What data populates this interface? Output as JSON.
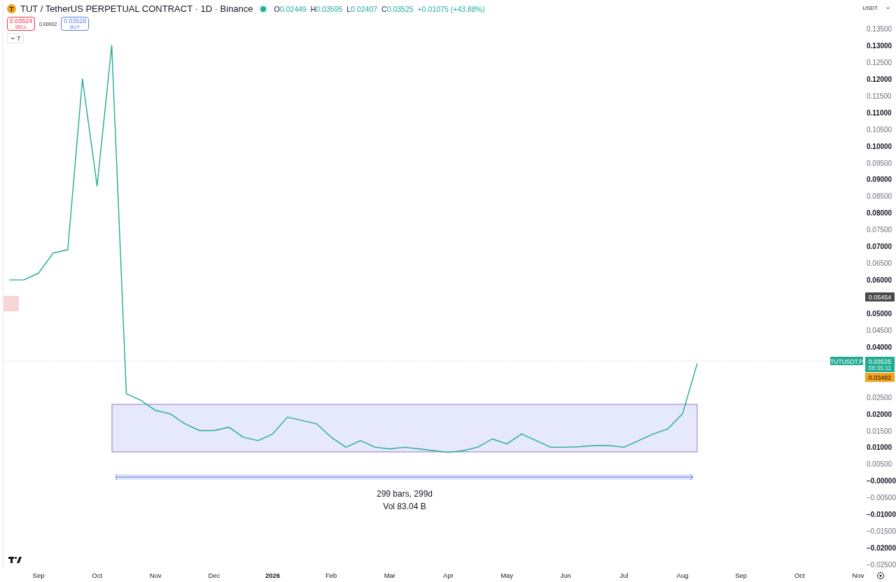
{
  "header": {
    "logo_letter": "T",
    "title": "TUT / TetherUS PERPETUAL CONTRACT · 1D · Binance",
    "market_open": true,
    "ohlc": [
      {
        "label": "O",
        "value": "0.02449"
      },
      {
        "label": "H",
        "value": "0.03595"
      },
      {
        "label": "L",
        "value": "0.02407"
      },
      {
        "label": "C",
        "value": "0.03525"
      }
    ],
    "change": "+0.01075 (+43.88%)",
    "sell": {
      "price": "0.03524",
      "label": "SELL"
    },
    "spread": "0.00002",
    "buy": {
      "price": "0.03526",
      "label": "BUY"
    },
    "indicators_count": "7"
  },
  "currency": "USDT",
  "chart": {
    "chart_data": {
      "type": "line",
      "categories": [
        null,
        null,
        "Sep",
        null,
        null,
        null,
        "Oct",
        null,
        null,
        null,
        "Nov",
        null,
        null,
        null,
        "Dec",
        null,
        null,
        null,
        "2026",
        null,
        null,
        null,
        "Feb",
        null,
        null,
        null,
        "Mar",
        null,
        null,
        null,
        "Apr",
        null,
        null,
        null,
        "May",
        null,
        null,
        null,
        "Jun",
        null,
        null,
        null,
        "Jul",
        null,
        null,
        null,
        "Aug",
        null,
        null,
        null,
        "Sep",
        null,
        null,
        null,
        "Oct",
        null,
        null,
        null,
        "Nov"
      ],
      "series": [
        {
          "name": "TUTUSDT.P",
          "color": "#22ab94",
          "values": [
            0.06,
            0.06,
            0.062,
            0.068,
            0.069,
            0.12,
            0.088,
            0.13,
            0.026,
            0.024,
            0.021,
            0.02,
            0.017,
            0.015,
            0.015,
            0.016,
            0.013,
            0.012,
            0.014,
            0.019,
            0.018,
            0.017,
            0.013,
            0.01,
            0.012,
            0.01,
            0.0095,
            0.01,
            0.0095,
            0.009,
            0.0085,
            0.009,
            0.01,
            0.0125,
            0.011,
            0.014,
            0.012,
            0.01,
            0.01,
            0.0102,
            0.0105,
            0.0105,
            0.01,
            0.012,
            0.014,
            0.0155,
            0.02,
            0.035,
            null,
            null,
            null,
            null,
            null,
            null,
            null,
            null,
            null,
            null,
            null
          ]
        }
      ],
      "ylim": [
        -0.025,
        0.135
      ],
      "yticks": [
        {
          "value": 0.135,
          "label": "0.13500"
        },
        {
          "value": 0.13,
          "label": "0.13000"
        },
        {
          "value": 0.125,
          "label": "0.12500"
        },
        {
          "value": 0.12,
          "label": "0.12000"
        },
        {
          "value": 0.115,
          "label": "0.11500"
        },
        {
          "value": 0.11,
          "label": "0.11000"
        },
        {
          "value": 0.105,
          "label": "0.10500"
        },
        {
          "value": 0.1,
          "label": "0.10000"
        },
        {
          "value": 0.095,
          "label": "0.09500"
        },
        {
          "value": 0.09,
          "label": "0.09000"
        },
        {
          "value": 0.085,
          "label": "0.08500"
        },
        {
          "value": 0.08,
          "label": "0.08000"
        },
        {
          "value": 0.075,
          "label": "0.07500"
        },
        {
          "value": 0.07,
          "label": "0.07000"
        },
        {
          "value": 0.065,
          "label": "0.06500"
        },
        {
          "value": 0.06,
          "label": "0.06000"
        },
        {
          "value": 0.05,
          "label": "0.05000"
        },
        {
          "value": 0.045,
          "label": "0.04500"
        },
        {
          "value": 0.04,
          "label": "0.04000"
        },
        {
          "value": 0.025,
          "label": "0.02500"
        },
        {
          "value": 0.02,
          "label": "0.02000"
        },
        {
          "value": 0.015,
          "label": "0.01500"
        },
        {
          "value": 0.01,
          "label": "0.01000"
        },
        {
          "value": 0.005,
          "label": "0.00500"
        },
        {
          "value": 0,
          "label": "−0.00000"
        },
        {
          "value": -0.005,
          "label": "−0.00500"
        },
        {
          "value": -0.01,
          "label": "−0.01000"
        },
        {
          "value": -0.015,
          "label": "−0.01500"
        },
        {
          "value": -0.02,
          "label": "−0.02000"
        },
        {
          "value": -0.025,
          "label": "−0.02500"
        }
      ]
    }
  },
  "price_axis_bold": [
    false,
    true,
    false,
    true,
    false,
    true,
    false,
    true,
    false,
    true,
    false,
    true,
    false,
    true,
    false,
    true,
    true,
    false,
    true,
    false,
    true,
    false,
    true,
    false,
    true,
    false,
    true,
    false,
    true,
    false
  ],
  "time_axis_bold": [
    false,
    false,
    false,
    false,
    true,
    false,
    false,
    false,
    false,
    false,
    false,
    false,
    false,
    false,
    false
  ],
  "drawings": [
    {
      "kind": "marker",
      "color": "#f7d4d6"
    },
    {
      "kind": "box",
      "color": "#e6e8fc"
    },
    {
      "kind": "range",
      "label": "299 bars, 299d",
      "sublabel": "Vol 83.04 B",
      "color": "#dde5fb"
    },
    {
      "kind": "level",
      "label": "0.05454",
      "color": "#4a4a4a"
    },
    {
      "kind": "last",
      "label": "0.03525",
      "sublabel": "08:35:11",
      "color": "#22ab94"
    },
    {
      "kind": "tag",
      "label": "0.03482",
      "color": "#f7a21b"
    }
  ]
}
